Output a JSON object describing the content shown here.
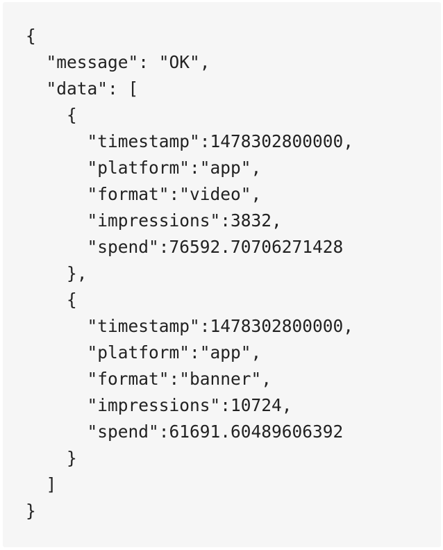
{
  "code": {
    "lines": [
      "{",
      "  \"message\": \"OK\",",
      "  \"data\": [",
      "    {",
      "      \"timestamp\":1478302800000,",
      "      \"platform\":\"app\",",
      "      \"format\":\"video\",",
      "      \"impressions\":3832,",
      "      \"spend\":76592.70706271428",
      "    },",
      "    {",
      "      \"timestamp\":1478302800000,",
      "      \"platform\":\"app\",",
      "      \"format\":\"banner\",",
      "      \"impressions\":10724,",
      "      \"spend\":61691.60489606392",
      "    }",
      "  ]",
      "}"
    ]
  }
}
